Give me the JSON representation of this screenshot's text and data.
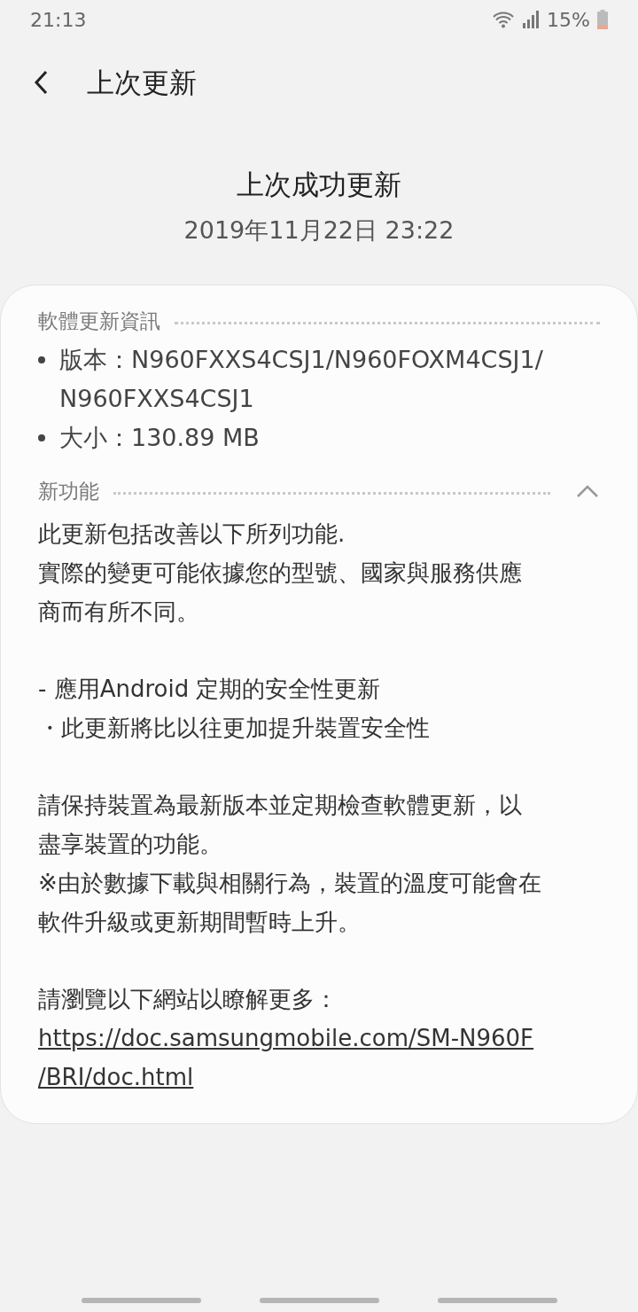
{
  "status_bar": {
    "time": "21:13",
    "battery": "15%"
  },
  "header": {
    "title": "上次更新"
  },
  "summary": {
    "title": "上次成功更新",
    "date": "2019年11月22日 23:22"
  },
  "info_section": {
    "title": "軟體更新資訊",
    "items": [
      {
        "lines": [
          "版本：N960FXXS4CSJ1/N960FOXM4CSJ1/",
          "N960FXXS4CSJ1"
        ]
      },
      {
        "lines": [
          "大小：130.89 MB"
        ]
      }
    ]
  },
  "features_section": {
    "title": "新功能",
    "expanded": true,
    "paragraphs": [
      {
        "lines": [
          {
            "kind": "text",
            "text": "此更新包括改善以下所列功能."
          },
          {
            "kind": "text",
            "text": "實際的變更可能依據您的型號、國家與服務供應"
          },
          {
            "kind": "text",
            "text": "商而有所不同。"
          }
        ]
      },
      {
        "lines": [
          {
            "kind": "text",
            "text": "- 應用Android 定期的安全性更新"
          },
          {
            "kind": "text",
            "text": "・此更新將比以往更加提升裝置安全性"
          }
        ]
      },
      {
        "lines": [
          {
            "kind": "text",
            "text": "請保持裝置為最新版本並定期檢查軟體更新，以"
          },
          {
            "kind": "text",
            "text": "盡享裝置的功能。"
          },
          {
            "kind": "text",
            "text": "※由於數據下載與相關行為，裝置的溫度可能會在"
          },
          {
            "kind": "text",
            "text": "軟件升級或更新期間暫時上升。"
          }
        ]
      },
      {
        "lines": [
          {
            "kind": "text",
            "text": "請瀏覽以下網站以瞭解更多："
          },
          {
            "kind": "link",
            "text": "https://doc.samsungmobile.com/SM-N960F"
          },
          {
            "kind": "link",
            "text": "/BRI/doc.html"
          }
        ]
      }
    ]
  }
}
